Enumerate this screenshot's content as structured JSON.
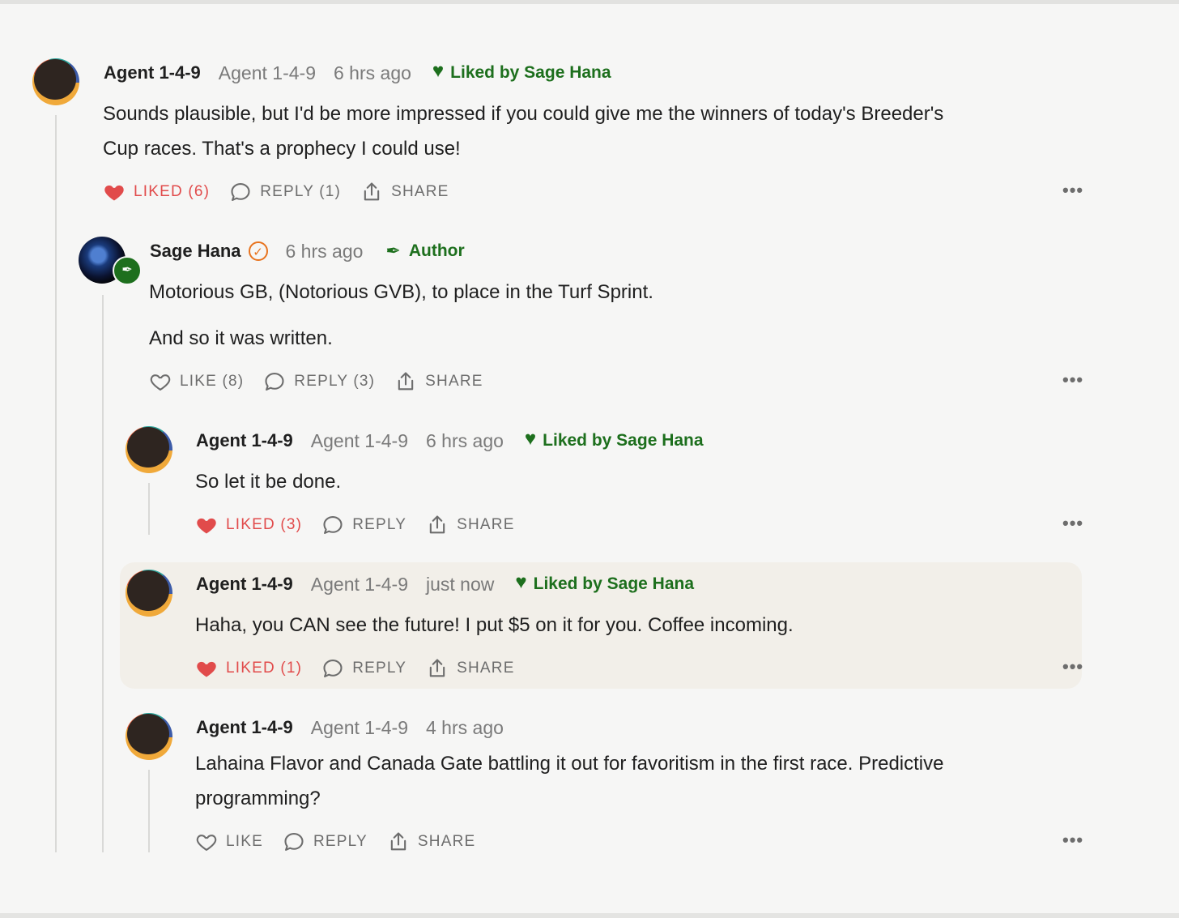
{
  "comments": [
    {
      "name": "Agent 1-4-9",
      "handle": "Agent 1-4-9",
      "time": "6 hrs ago",
      "liked_by": "Liked by Sage Hana",
      "body": [
        "Sounds plausible, but I'd be more impressed if you could give me the winners of today's Breeder's",
        "Cup races. That's a prophecy I could use!"
      ],
      "like_label": "LIKED (6)",
      "reply_label": "REPLY (1)",
      "share_label": "SHARE",
      "liked": true
    },
    {
      "name": "Sage Hana",
      "time": "6 hrs ago",
      "author_label": "Author",
      "body": [
        "Motorious GB, (Notorious GVB), to place in the Turf Sprint.",
        "And so it was written."
      ],
      "like_label": "LIKE (8)",
      "reply_label": "REPLY (3)",
      "share_label": "SHARE",
      "liked": false
    },
    {
      "name": "Agent 1-4-9",
      "handle": "Agent 1-4-9",
      "time": "6 hrs ago",
      "liked_by": "Liked by Sage Hana",
      "body": [
        "So let it be done."
      ],
      "like_label": "LIKED (3)",
      "reply_label": "REPLY",
      "share_label": "SHARE",
      "liked": true
    },
    {
      "name": "Agent 1-4-9",
      "handle": "Agent 1-4-9",
      "time": "just now",
      "liked_by": "Liked by Sage Hana",
      "body": [
        "Haha, you CAN see the future! I put $5 on it for you. Coffee incoming."
      ],
      "like_label": "LIKED (1)",
      "reply_label": "REPLY",
      "share_label": "SHARE",
      "liked": true,
      "highlighted": true
    },
    {
      "name": "Agent 1-4-9",
      "handle": "Agent 1-4-9",
      "time": "4 hrs ago",
      "body": [
        "Lahaina Flavor and Canada Gate battling it out for favoritism in the first race. Predictive",
        "programming?"
      ],
      "like_label": "LIKE",
      "reply_label": "REPLY",
      "share_label": "SHARE",
      "liked": false
    }
  ],
  "more_label": "•••",
  "colors": {
    "liked": "#e14b4b",
    "author_green": "#1d6f1d",
    "verified_orange": "#e8731e",
    "highlight_bg": "#f2efe9"
  }
}
